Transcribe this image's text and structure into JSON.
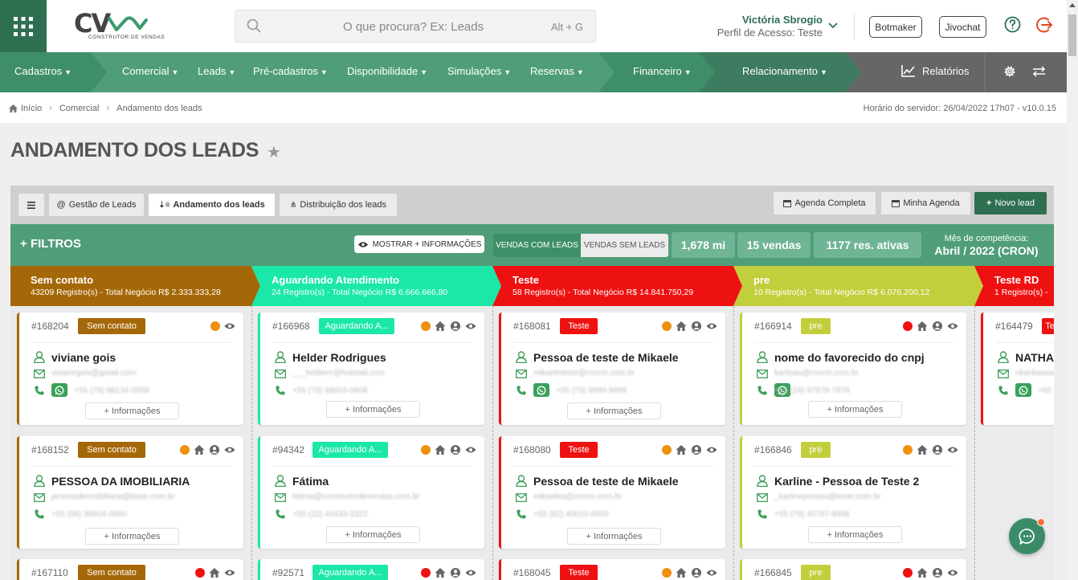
{
  "topbar": {
    "logo_text": "CV",
    "logo_sub": "CONSTRUTOR DE VENDAS",
    "search_placeholder": "O que procura? Ex: Leads",
    "search_shortcut": "Alt + G",
    "user_name": "Victória Sbrogio",
    "user_profile": "Perfil de Acesso: Teste",
    "botmaker": "Botmaker",
    "jivochat": "Jivochat"
  },
  "nav": {
    "items": [
      {
        "label": "Cadastros"
      },
      {
        "label": "Comercial"
      },
      {
        "label": "Leads"
      },
      {
        "label": "Pré-cadastros"
      },
      {
        "label": "Disponibilidade"
      },
      {
        "label": "Simulações"
      },
      {
        "label": "Reservas"
      },
      {
        "label": "Financeiro"
      },
      {
        "label": "Relacionamento"
      }
    ],
    "relatorios": "Relatórios"
  },
  "breadcrumb": {
    "items": [
      "Início",
      "Comercial",
      "Andamento dos leads"
    ],
    "server_time": "Horário do servidor: 26/04/2022 17h07 - v10.0.15"
  },
  "page": {
    "title": "ANDAMENTO DOS LEADS"
  },
  "toolbar": {
    "tabs": [
      "Gestão de Leads",
      "Andamento dos leads",
      "Distribuição dos leads"
    ],
    "agenda_completa": "Agenda Completa",
    "minha_agenda": "Minha Agenda",
    "novo_lead": "Novo lead"
  },
  "filters": {
    "title": "FILTROS",
    "mostrar": "MOSTRAR + INFORMAÇÕES",
    "vendas_com": "VENDAS COM LEADS",
    "vendas_sem": "VENDAS SEM LEADS",
    "stat_mi": "1,678 mi",
    "stat_vendas": "15 vendas",
    "stat_reservas": "1177 res. ativas",
    "competencia_label": "Mês de competência:",
    "competencia_value": "Abril / 2022 (CRON)"
  },
  "colors": {
    "sem_contato": "#a56808",
    "aguardando": "#1be8a8",
    "teste": "#ee1111",
    "pre": "#c2cf3c",
    "dark_green": "#2e6f52",
    "nav_green": "#4f9e79"
  },
  "columns": [
    {
      "title": "Sem contato",
      "subtitle": "43209 Registro(s) - Total Negócio R$ 2.333.333,28",
      "cards": [
        {
          "id": "#168204",
          "badge": "Sem contato",
          "name": "viviane gois",
          "email": "vivianegois@gmail.com",
          "phone": "+55 (79) 98134-0058",
          "whatsapp": true,
          "more": "+ Informações",
          "dot": "#f0900f",
          "icons": [
            "eye"
          ]
        },
        {
          "id": "#168152",
          "badge": "Sem contato",
          "name": "PESSOA DA IMOBILIARIA",
          "email": "pessoadeimobiliaria@teste.com.br",
          "phone": "+55 (66) 98404-0560",
          "whatsapp": false,
          "more": "+ Informações",
          "dot": "#f0900f",
          "icons": [
            "home",
            "user",
            "eye"
          ]
        },
        {
          "id": "#167110",
          "badge": "Sem contato",
          "dot": "#ee1111",
          "icons": [
            "home",
            "eye"
          ]
        }
      ]
    },
    {
      "title": "Aguardando Atendimento",
      "subtitle": "24 Registro(s) - Total Negócio R$ 6.666.666,80",
      "cards": [
        {
          "id": "#166968",
          "badge": "Aguardando A...",
          "name": "Helder Rodrigues",
          "email": "___helderrr@hotmail.com",
          "phone": "+55 (79) 98003-0608",
          "whatsapp": false,
          "more": "+ Informações",
          "dot": "#f0900f",
          "icons": [
            "home",
            "user",
            "eye"
          ]
        },
        {
          "id": "#94342",
          "badge": "Aguardando A...",
          "name": "Fátima",
          "email": "fatima@construtordevendas.com.br",
          "phone": "+55 (32) 44433-3322",
          "whatsapp": false,
          "more": "+ Informações",
          "dot": "#f0900f",
          "icons": [
            "home",
            "user",
            "eye"
          ]
        },
        {
          "id": "#92571",
          "badge": "Aguardando A...",
          "dot": "#ee1111",
          "icons": [
            "home",
            "user",
            "eye"
          ]
        }
      ]
    },
    {
      "title": "Teste",
      "subtitle": "58 Registro(s) - Total Negócio R$ 14.841.750,29",
      "cards": [
        {
          "id": "#168081",
          "badge": "Teste",
          "name": "Pessoa de teste de Mikaele",
          "email": "mikaeleteste@cvcrm.com.br",
          "phone": "+55 (79) 9999-9999",
          "whatsapp": true,
          "more": "+ Informações",
          "dot": "#f0900f",
          "icons": [
            "home",
            "user",
            "eye"
          ]
        },
        {
          "id": "#168080",
          "badge": "Teste",
          "name": "Pessoa de teste de Mikaele",
          "email": "mikaelea@cvcrm.com.br",
          "phone": "+55 (82) 40010-0000",
          "whatsapp": false,
          "more": "+ Informações",
          "dot": "#f0900f",
          "icons": [
            "home",
            "user",
            "eye"
          ]
        },
        {
          "id": "#168045",
          "badge": "Teste",
          "dot": "#f0900f",
          "icons": [
            "home",
            "user",
            "eye"
          ]
        }
      ]
    },
    {
      "title": "pre",
      "subtitle": "10 Registro(s) - Total Negócio R$ 6.076.200,12",
      "cards": [
        {
          "id": "#166914",
          "badge": "pre",
          "name": "nome do favorecido do cnpj",
          "email": "karlinas@cvcrm.com.br",
          "phone": "+55 (24) 97878-7878",
          "whatsapp": true,
          "more": "+ Informações",
          "dot": "#ee1111",
          "icons": [
            "home",
            "user",
            "eye"
          ]
        },
        {
          "id": "#166846",
          "badge": "pre",
          "name": "Karline - Pessoa de Teste 2",
          "email": "_karlinepessoa@teste.com.br",
          "phone": "+55 (79) 45787-8456",
          "whatsapp": false,
          "more": "+ Informações",
          "dot": "#f0900f",
          "icons": [
            "home",
            "user",
            "eye"
          ]
        },
        {
          "id": "#166845",
          "badge": "pre",
          "dot": "#ee1111",
          "icons": [
            "home",
            "user",
            "eye"
          ]
        }
      ]
    },
    {
      "title": "Teste RD",
      "subtitle": "1 Registro(s) - ",
      "cards": [
        {
          "id": "#164479",
          "badge": "Te",
          "name": "NATHA",
          "email": "nkanbaasso@",
          "phone": "+55",
          "whatsapp": true
        }
      ]
    }
  ]
}
